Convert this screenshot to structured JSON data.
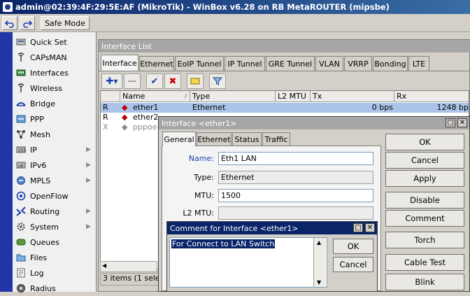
{
  "window": {
    "title": "admin@02:39:4F:29:5E:AF (MikroTik) - WinBox v6.28 on RB MetaROUTER (mipsbe)"
  },
  "toolbar": {
    "undo_icon": "undo-icon",
    "redo_icon": "redo-icon",
    "safe_mode_label": "Safe Mode"
  },
  "sidebar": {
    "items": [
      {
        "label": "Quick Set",
        "icon": "quickset-icon",
        "has_submenu": false
      },
      {
        "label": "CAPsMAN",
        "icon": "capsman-icon",
        "has_submenu": false
      },
      {
        "label": "Interfaces",
        "icon": "interfaces-icon",
        "has_submenu": false
      },
      {
        "label": "Wireless",
        "icon": "wireless-icon",
        "has_submenu": false
      },
      {
        "label": "Bridge",
        "icon": "bridge-icon",
        "has_submenu": false
      },
      {
        "label": "PPP",
        "icon": "ppp-icon",
        "has_submenu": false
      },
      {
        "label": "Mesh",
        "icon": "mesh-icon",
        "has_submenu": false
      },
      {
        "label": "IP",
        "icon": "ip-icon",
        "has_submenu": true
      },
      {
        "label": "IPv6",
        "icon": "ipv6-icon",
        "has_submenu": true
      },
      {
        "label": "MPLS",
        "icon": "mpls-icon",
        "has_submenu": true
      },
      {
        "label": "OpenFlow",
        "icon": "openflow-icon",
        "has_submenu": false
      },
      {
        "label": "Routing",
        "icon": "routing-icon",
        "has_submenu": true
      },
      {
        "label": "System",
        "icon": "system-icon",
        "has_submenu": true
      },
      {
        "label": "Queues",
        "icon": "queues-icon",
        "has_submenu": false
      },
      {
        "label": "Files",
        "icon": "files-icon",
        "has_submenu": false
      },
      {
        "label": "Log",
        "icon": "log-icon",
        "has_submenu": false
      },
      {
        "label": "Radius",
        "icon": "radius-icon",
        "has_submenu": false
      }
    ]
  },
  "interface_list": {
    "title": "Interface List",
    "tabs": [
      "Interface",
      "Ethernet",
      "EoIP Tunnel",
      "IP Tunnel",
      "GRE Tunnel",
      "VLAN",
      "VRRP",
      "Bonding",
      "LTE"
    ],
    "active_tab": "Interface",
    "columns": [
      "",
      "Name",
      "Type",
      "L2 MTU",
      "Tx",
      "Rx"
    ],
    "rows": [
      {
        "flag": "R",
        "name": "ether1",
        "type": "Ethernet",
        "l2mtu": "",
        "tx": "0 bps",
        "rx": "1248 bp",
        "selected": true
      },
      {
        "flag": "R",
        "name": "ether2",
        "type": "",
        "l2mtu": "",
        "tx": "",
        "rx": "",
        "selected": false
      },
      {
        "flag": "X",
        "name": "pppoe-",
        "type": "",
        "l2mtu": "",
        "tx": "",
        "rx": "",
        "selected": false
      }
    ],
    "status": "3 items (1 selecte"
  },
  "interface_dialog": {
    "title": "Interface <ether1>",
    "tabs": [
      "General",
      "Ethernet",
      "Status",
      "Traffic"
    ],
    "active_tab": "General",
    "fields": {
      "name_label": "Name:",
      "name_value": "Eth1 LAN",
      "type_label": "Type:",
      "type_value": "Ethernet",
      "mtu_label": "MTU:",
      "mtu_value": "1500",
      "l2mtu_label": "L2 MTU:",
      "l2mtu_value": ""
    },
    "buttons": [
      "OK",
      "Cancel",
      "Apply",
      "Disable",
      "Comment",
      "Torch",
      "Cable Test",
      "Blink"
    ]
  },
  "comment_dialog": {
    "title": "Comment for Interface <ether1>",
    "text": "For Connect to LAN Switch",
    "ok_label": "OK",
    "cancel_label": "Cancel"
  },
  "colors": {
    "title_active": "#0a246a",
    "title_inactive": "#a6a6a6",
    "sidebar_strip": "#2336a8",
    "selected_row": "#a9c4e8",
    "remove_red": "#cc0000",
    "apply_blue": "#1a3fb0"
  }
}
